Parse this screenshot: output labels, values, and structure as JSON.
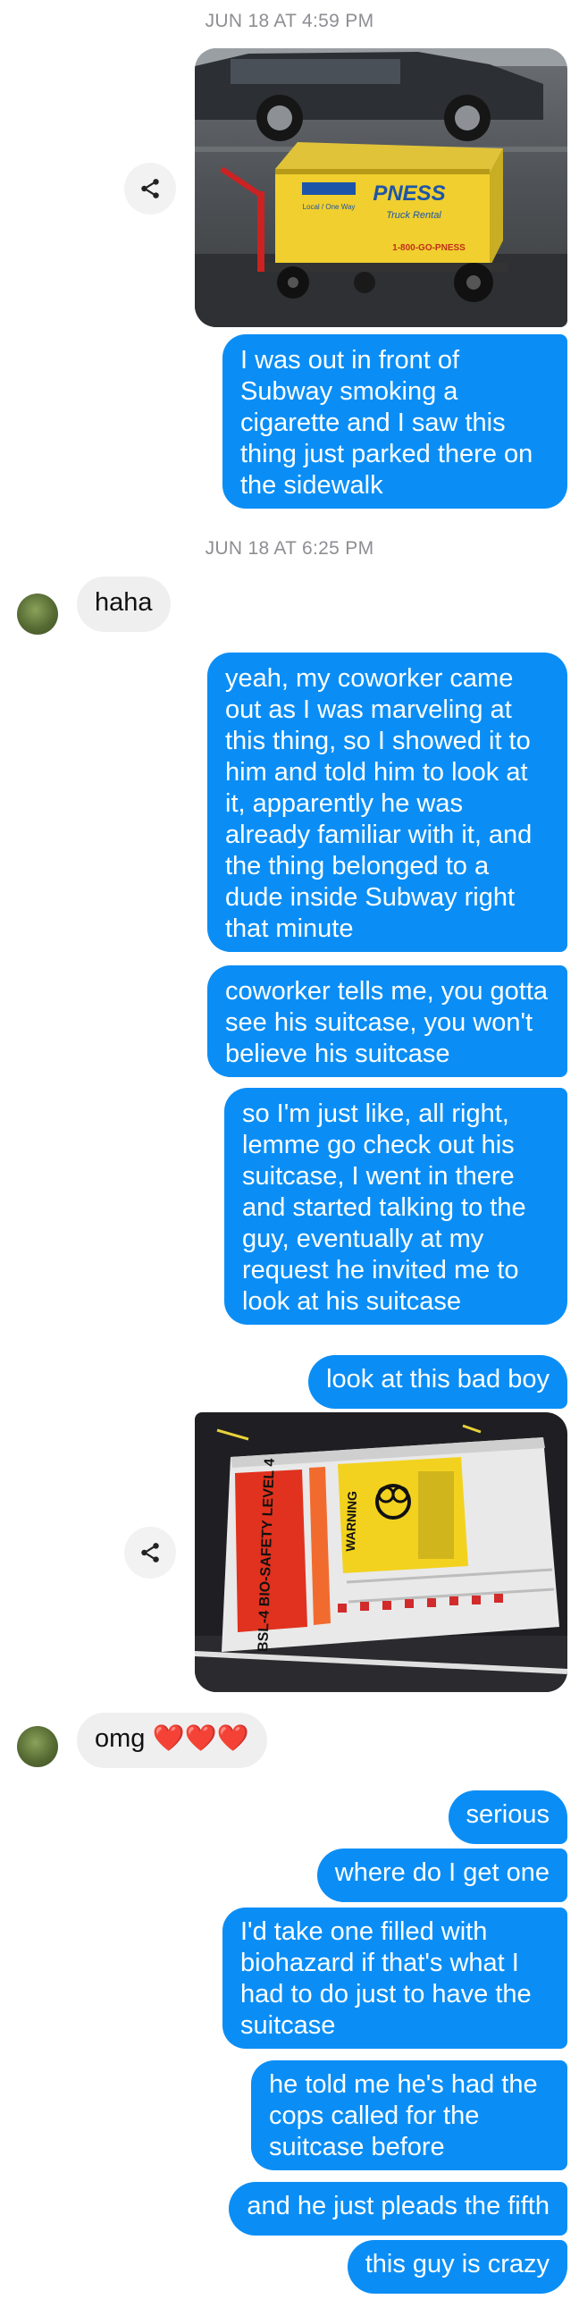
{
  "timestamps": [
    "JUN 18 AT 4:59 PM",
    "JUN 18 AT 6:25 PM"
  ],
  "photos": [
    {
      "description_icon": "cart-photo",
      "box_brand": "PNESS",
      "box_sub": "Truck Rental",
      "box_phone": "1-800-GO-PNESS",
      "box_small": "Local / One Way"
    },
    {
      "description_icon": "suitcase-photo",
      "label_red": "BSL-4 BIO-SAFETY LEVEL 4",
      "label_warning": "WARNING"
    }
  ],
  "messages": {
    "m1": "I was out in front of Subway smoking a cigarette and I saw this thing just parked there on the sidewalk",
    "m2": "haha",
    "m3": "yeah, my coworker came out as I was marveling at this thing, so I showed it to him and told him to look at it, apparently he was already familiar with it, and the thing belonged to a dude inside Subway right that minute",
    "m4": "coworker tells me, you gotta see his suitcase, you won't believe his suitcase",
    "m5": "so I'm just like, all right, lemme go check out his suitcase, I went in there and started talking to the guy, eventually at my request he invited me to look at his suitcase",
    "m6": "look at this bad boy",
    "m7_text": "omg",
    "m7_hearts": "❤️❤️❤️",
    "m8": "serious",
    "m9": "where do I get one",
    "m10": "I'd take one filled with biohazard if that's what I had to do just to have the suitcase",
    "m11": "he told me he's had the cops called for the suitcase before",
    "m12": "and he just pleads the fifth",
    "m13": "this guy is crazy"
  },
  "colors": {
    "outgoing": "#0a8ef6",
    "incoming": "#efefef",
    "timestamp": "#8e8e93"
  },
  "icons": [
    "share-icon",
    "avatar"
  ]
}
